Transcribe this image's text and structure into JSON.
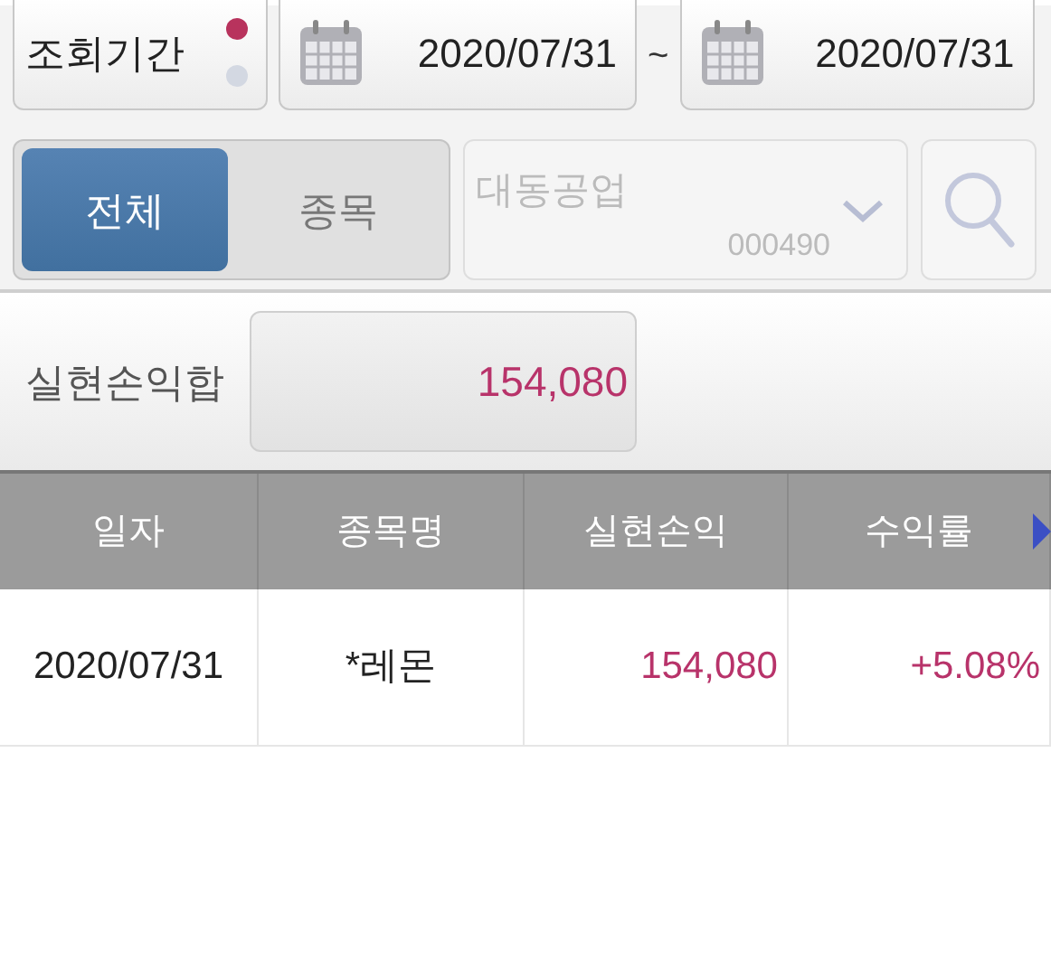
{
  "period": {
    "label": "조회기간",
    "dots": [
      {
        "selected": true
      },
      {
        "selected": false
      }
    ],
    "from": "2020/07/31",
    "separator": "~",
    "to": "2020/07/31"
  },
  "tabs": [
    {
      "label": "전체",
      "selected": true
    },
    {
      "label": "종목",
      "selected": false
    }
  ],
  "stock_picker": {
    "name": "대동공업",
    "code": "000490",
    "disabled": true
  },
  "summary": {
    "label": "실현손익합",
    "value": "154,080"
  },
  "table": {
    "columns": [
      "일자",
      "종목명",
      "실현손익",
      "수익률"
    ],
    "rows": [
      [
        "2020/07/31",
        "*레몬",
        "154,080",
        "+5.08%"
      ]
    ]
  }
}
